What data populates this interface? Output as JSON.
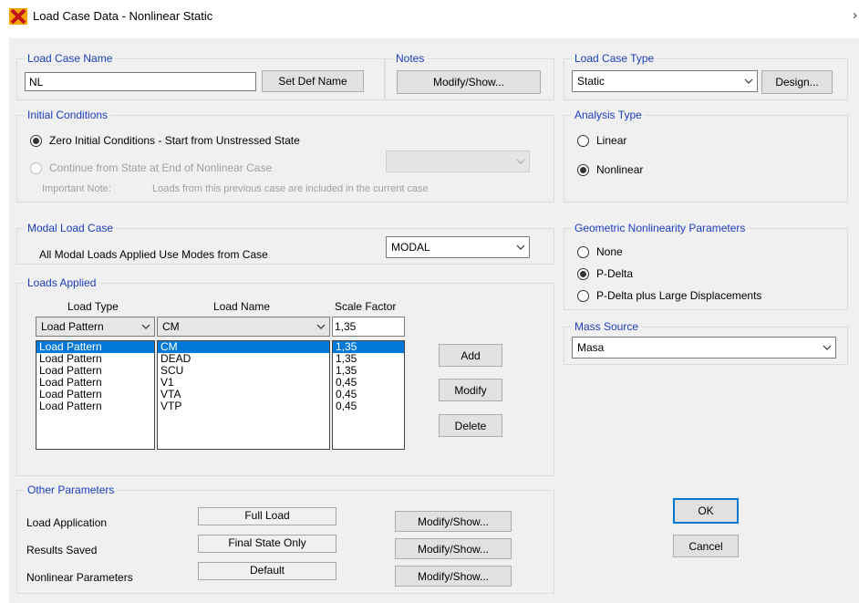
{
  "window": {
    "title": "Load Case Data - Nonlinear Static"
  },
  "load_case_name": {
    "legend": "Load Case Name",
    "value": "NL",
    "set_def_button": "Set Def Name"
  },
  "notes": {
    "legend": "Notes",
    "modify_button": "Modify/Show..."
  },
  "load_case_type": {
    "legend": "Load Case Type",
    "selected": "Static",
    "design_button": "Design..."
  },
  "initial_conditions": {
    "legend": "Initial Conditions",
    "zero_label": "Zero Initial Conditions - Start from Unstressed State",
    "continue_label": "Continue from State at End of Nonlinear Case",
    "note_label": "Important Note:",
    "note_text": "Loads from this previous case are included in the current case",
    "selected": "zero"
  },
  "analysis_type": {
    "legend": "Analysis Type",
    "linear_label": "Linear",
    "nonlinear_label": "Nonlinear",
    "selected": "nonlinear"
  },
  "modal_load_case": {
    "legend": "Modal Load Case",
    "label": "All Modal Loads Applied Use Modes from Case",
    "selected": "MODAL"
  },
  "geometric_nonlinearity": {
    "legend": "Geometric Nonlinearity Parameters",
    "none_label": "None",
    "pdelta_label": "P-Delta",
    "pdelta_large_label": "P-Delta plus Large Displacements",
    "selected": "pdelta"
  },
  "loads_applied": {
    "legend": "Loads Applied",
    "headers": {
      "load_type": "Load Type",
      "load_name": "Load Name",
      "scale_factor": "Scale Factor"
    },
    "current": {
      "load_type": "Load Pattern",
      "load_name": "CM",
      "scale_factor": "1,35"
    },
    "rows": [
      {
        "load_type": "Load Pattern",
        "load_name": "CM",
        "scale_factor": "1,35"
      },
      {
        "load_type": "Load Pattern",
        "load_name": "DEAD",
        "scale_factor": "1,35"
      },
      {
        "load_type": "Load Pattern",
        "load_name": "SCU",
        "scale_factor": "1,35"
      },
      {
        "load_type": "Load Pattern",
        "load_name": "V1",
        "scale_factor": "0,45"
      },
      {
        "load_type": "Load Pattern",
        "load_name": "VTA",
        "scale_factor": "0,45"
      },
      {
        "load_type": "Load Pattern",
        "load_name": "VTP",
        "scale_factor": "0,45"
      }
    ],
    "selected_row": 0,
    "add_button": "Add",
    "modify_button": "Modify",
    "delete_button": "Delete"
  },
  "mass_source": {
    "legend": "Mass Source",
    "selected": "Masa"
  },
  "other_parameters": {
    "legend": "Other Parameters",
    "load_application": {
      "label": "Load Application",
      "value": "Full Load",
      "button": "Modify/Show..."
    },
    "results_saved": {
      "label": "Results Saved",
      "value": "Final State Only",
      "button": "Modify/Show..."
    },
    "nonlinear_parameters": {
      "label": "Nonlinear Parameters",
      "value": "Default",
      "button": "Modify/Show..."
    }
  },
  "dialog_buttons": {
    "ok": "OK",
    "cancel": "Cancel"
  },
  "colors": {
    "legend_text": "#1a3dbd",
    "selection": "#0078d7",
    "panel": "#f0f0f0"
  }
}
